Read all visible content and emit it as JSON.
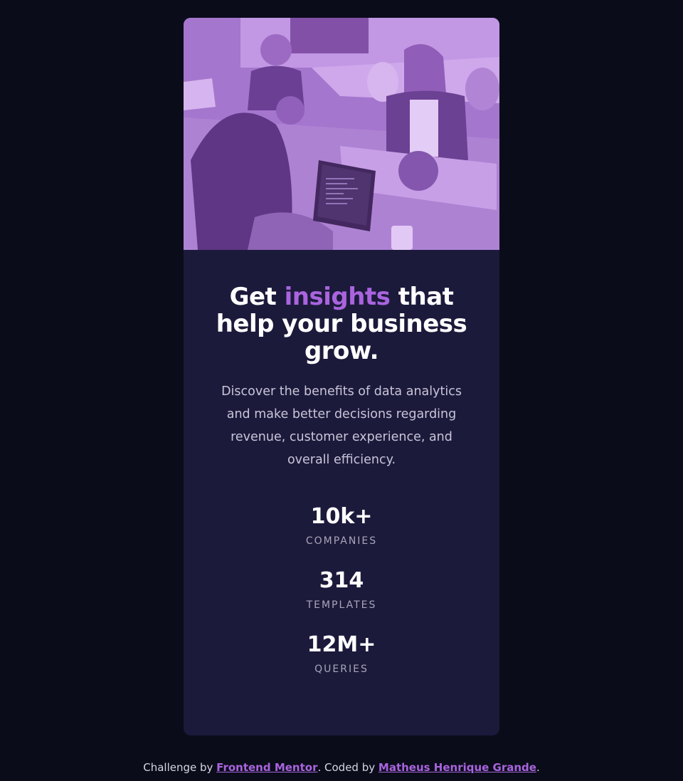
{
  "colors": {
    "background": "#0a0c1a",
    "card": "#1c1a3b",
    "accent": "#a964de",
    "image_tint": "#9c6fc4"
  },
  "hero": {
    "image_alt": "people working at a table with laptops (purple tinted photo)"
  },
  "headline": {
    "part1": "Get ",
    "accent": "insights",
    "part2": " that help your business grow."
  },
  "description": "Discover the benefits of data analytics and make better decisions regarding revenue, customer experience, and overall efficiency.",
  "stats": [
    {
      "value": "10k+",
      "label": "COMPANIES"
    },
    {
      "value": "314",
      "label": "TEMPLATES"
    },
    {
      "value": "12M+",
      "label": "QUERIES"
    }
  ],
  "footer": {
    "prefix": "Challenge by ",
    "link1": "Frontend Mentor",
    "middle": ". Coded by ",
    "link2": "Matheus Henrique Grande",
    "suffix": "."
  }
}
